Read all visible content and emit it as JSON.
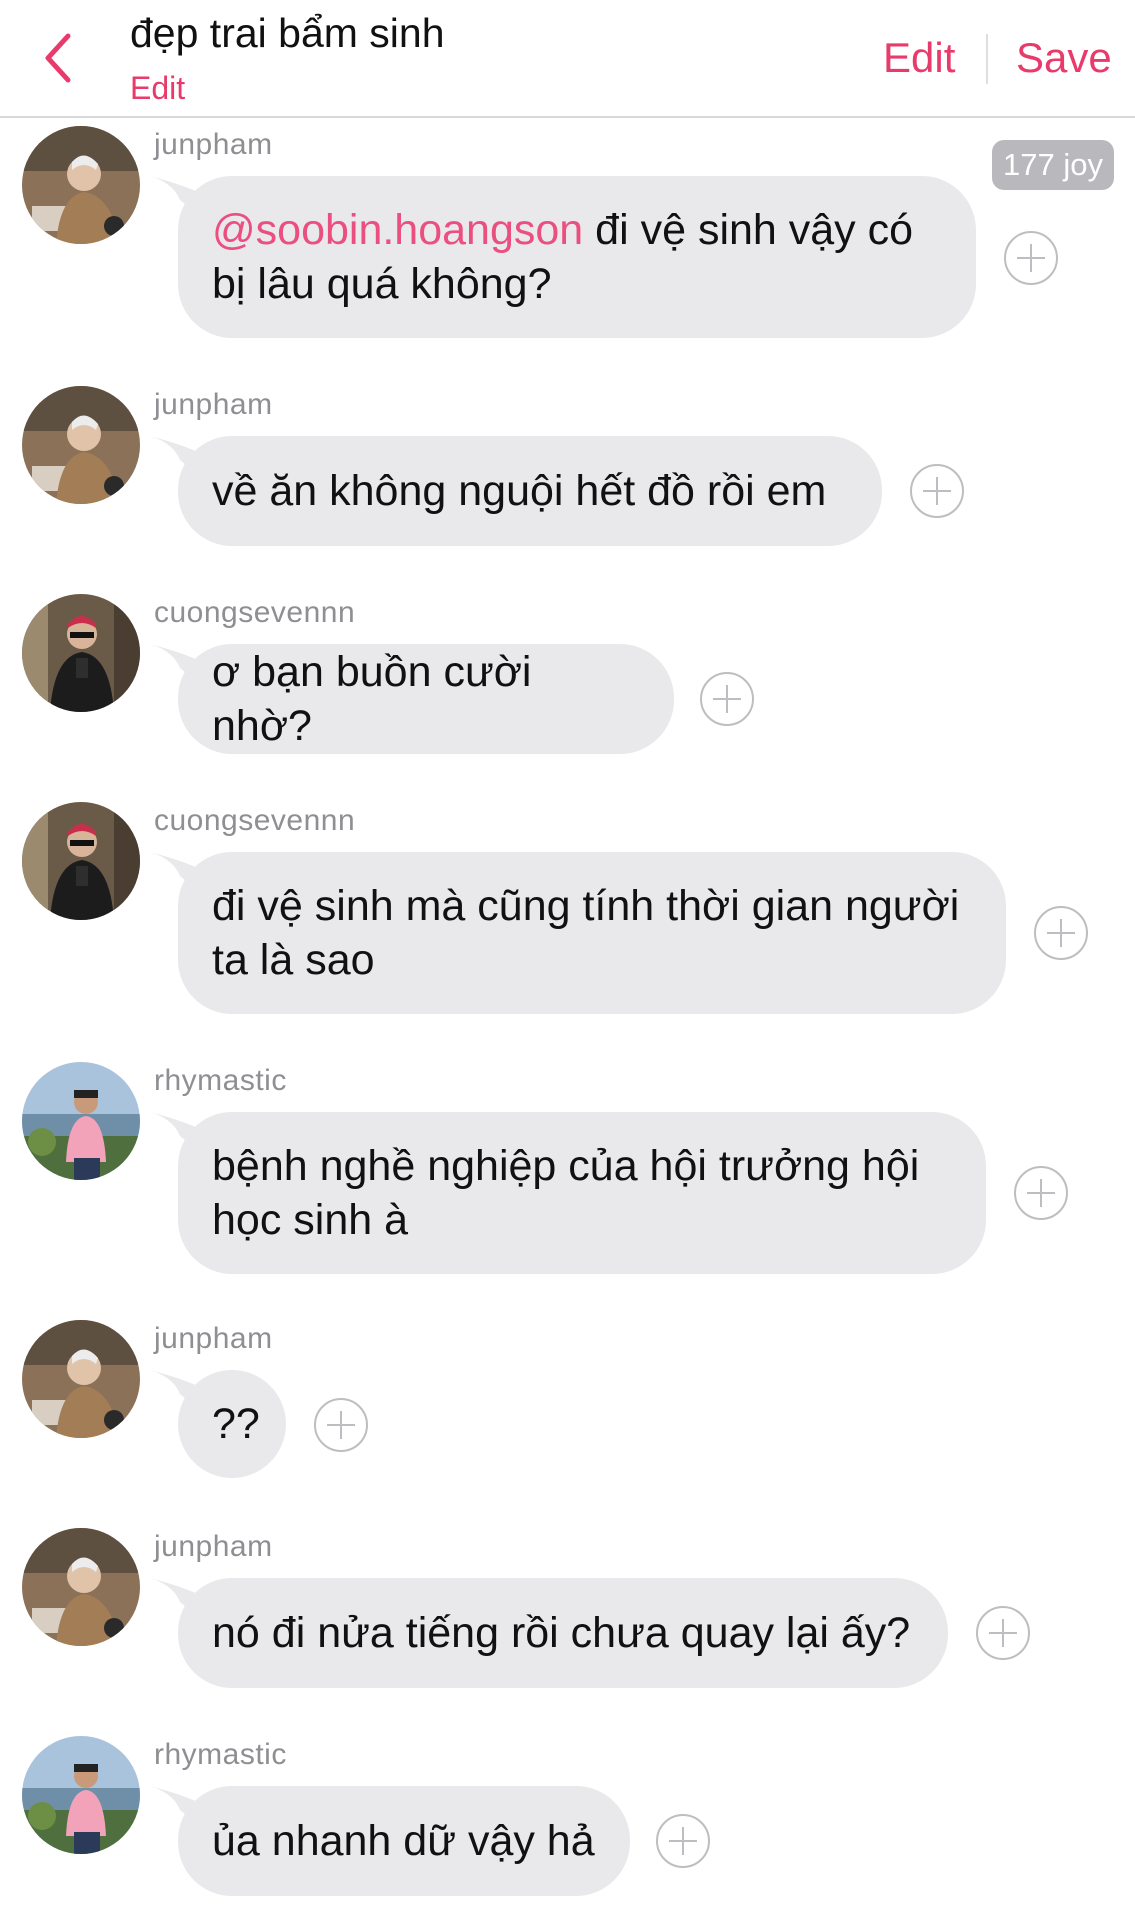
{
  "header": {
    "title": "đẹp trai bẩm sinh",
    "subtitle": "Edit",
    "edit_label": "Edit",
    "save_label": "Save",
    "accent_color": "#e83a6b"
  },
  "joy_badge": "177 joy",
  "messages": [
    {
      "user": "junpham",
      "mention": "@soobin.hoangson",
      "text": " đi vệ sinh vậy có bị lâu quá không?"
    },
    {
      "user": "junpham",
      "text": "về ăn không nguội hết đồ rồi em"
    },
    {
      "user": "cuongsevennn",
      "text": "ơ bạn buồn cười nhờ?"
    },
    {
      "user": "cuongsevennn",
      "text": "đi vệ sinh mà cũng tính thời gian người ta là sao"
    },
    {
      "user": "rhymastic",
      "text": "bệnh nghề nghiệp của hội trưởng hội học sinh à"
    },
    {
      "user": "junpham",
      "text": "??"
    },
    {
      "user": "junpham",
      "text": "nó đi nửa tiếng rồi chưa quay lại ấy?"
    },
    {
      "user": "rhymastic",
      "text": "ủa nhanh dữ vậy hả"
    }
  ]
}
